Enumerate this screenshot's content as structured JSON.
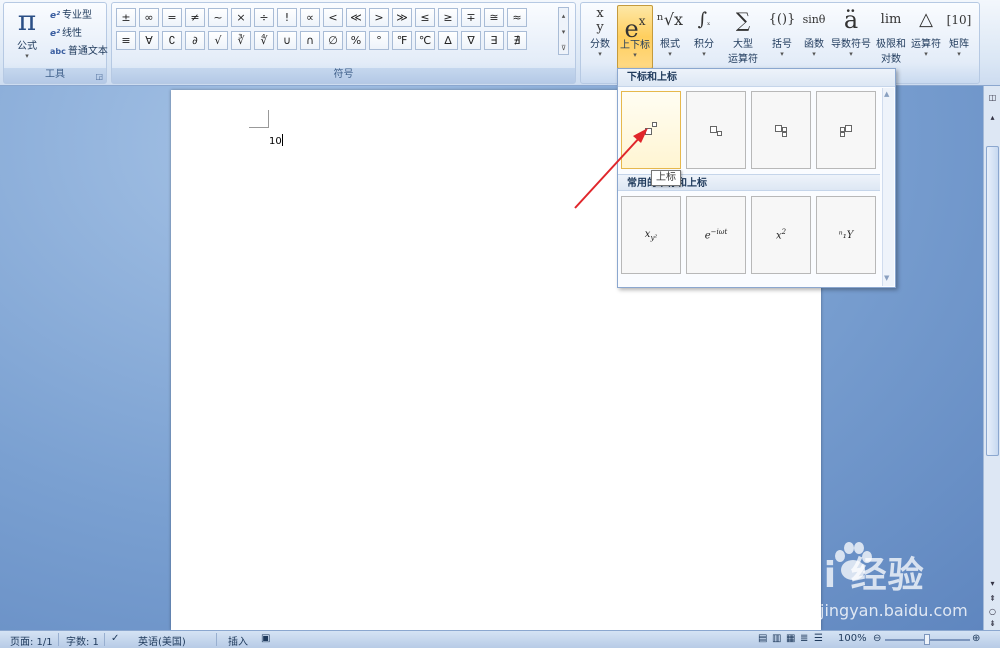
{
  "ribbon": {
    "tools_group": {
      "label": "工具",
      "formula_label": "公式",
      "professional": "专业型",
      "linear": "线性",
      "plain_text": "普通文本",
      "abc": "abc"
    },
    "symbols_group": {
      "label": "符号",
      "row1": [
        "±",
        "∞",
        "=",
        "≠",
        "~",
        "×",
        "÷",
        "!",
        "∝",
        "<",
        "≪",
        ">",
        "≫",
        "≤",
        "≥",
        "∓",
        "≅",
        "≈"
      ],
      "row2": [
        "≡",
        "∀",
        "∁",
        "∂",
        "√",
        "∛",
        "∜",
        "∪",
        "∩",
        "∅",
        "%",
        "°",
        "℉",
        "℃",
        "∆",
        "∇",
        "∃",
        "∄"
      ]
    },
    "structures": [
      {
        "icon": "x/y",
        "label": "分数"
      },
      {
        "icon": "eˣ",
        "label": "上下标"
      },
      {
        "icon": "ⁿ√x",
        "label": "根式"
      },
      {
        "icon": "∫",
        "label": "积分"
      },
      {
        "icon": "∑",
        "label": "大型",
        "label2": "运算符"
      },
      {
        "icon": "{()}",
        "label": "括号"
      },
      {
        "icon": "sinθ",
        "label": "函数"
      },
      {
        "icon": "ä",
        "label": "导数符号"
      },
      {
        "icon": "lim",
        "label": "极限和",
        "label2": "对数"
      },
      {
        "icon": "△",
        "label": "运算符"
      },
      {
        "icon": "[10]",
        "label": "矩阵"
      }
    ]
  },
  "gallery": {
    "header": "下标和上标",
    "header2": "常用的下标和上标",
    "common": [
      "x_{y²}",
      "e^{−iωt}",
      "x²",
      "ⁿ₁Y"
    ]
  },
  "tooltip": "上标",
  "document": {
    "text": "10"
  },
  "status": {
    "page": "页面: 1/1",
    "words": "字数: 1",
    "language": "英语(美国)",
    "mode": "插入",
    "zoom": "100%"
  },
  "watermark": {
    "brand": "Bai  经验",
    "url": "jingyan.baidu.com"
  },
  "colors": {
    "accent": "#ffcf5e",
    "arrow": "#e0262b"
  }
}
